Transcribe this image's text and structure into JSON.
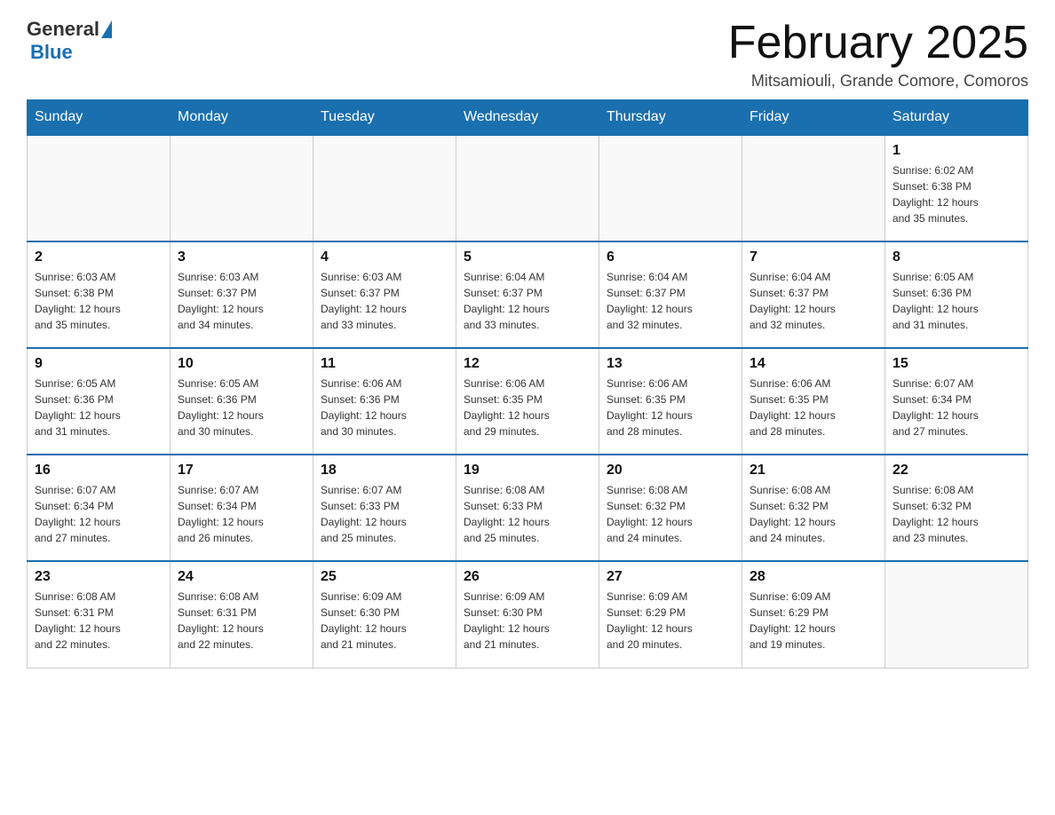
{
  "header": {
    "logo": {
      "part1": "General",
      "part2": "Blue"
    },
    "title": "February 2025",
    "location": "Mitsamiouli, Grande Comore, Comoros"
  },
  "weekdays": [
    "Sunday",
    "Monday",
    "Tuesday",
    "Wednesday",
    "Thursday",
    "Friday",
    "Saturday"
  ],
  "weeks": [
    [
      {
        "day": "",
        "info": ""
      },
      {
        "day": "",
        "info": ""
      },
      {
        "day": "",
        "info": ""
      },
      {
        "day": "",
        "info": ""
      },
      {
        "day": "",
        "info": ""
      },
      {
        "day": "",
        "info": ""
      },
      {
        "day": "1",
        "info": "Sunrise: 6:02 AM\nSunset: 6:38 PM\nDaylight: 12 hours\nand 35 minutes."
      }
    ],
    [
      {
        "day": "2",
        "info": "Sunrise: 6:03 AM\nSunset: 6:38 PM\nDaylight: 12 hours\nand 35 minutes."
      },
      {
        "day": "3",
        "info": "Sunrise: 6:03 AM\nSunset: 6:37 PM\nDaylight: 12 hours\nand 34 minutes."
      },
      {
        "day": "4",
        "info": "Sunrise: 6:03 AM\nSunset: 6:37 PM\nDaylight: 12 hours\nand 33 minutes."
      },
      {
        "day": "5",
        "info": "Sunrise: 6:04 AM\nSunset: 6:37 PM\nDaylight: 12 hours\nand 33 minutes."
      },
      {
        "day": "6",
        "info": "Sunrise: 6:04 AM\nSunset: 6:37 PM\nDaylight: 12 hours\nand 32 minutes."
      },
      {
        "day": "7",
        "info": "Sunrise: 6:04 AM\nSunset: 6:37 PM\nDaylight: 12 hours\nand 32 minutes."
      },
      {
        "day": "8",
        "info": "Sunrise: 6:05 AM\nSunset: 6:36 PM\nDaylight: 12 hours\nand 31 minutes."
      }
    ],
    [
      {
        "day": "9",
        "info": "Sunrise: 6:05 AM\nSunset: 6:36 PM\nDaylight: 12 hours\nand 31 minutes."
      },
      {
        "day": "10",
        "info": "Sunrise: 6:05 AM\nSunset: 6:36 PM\nDaylight: 12 hours\nand 30 minutes."
      },
      {
        "day": "11",
        "info": "Sunrise: 6:06 AM\nSunset: 6:36 PM\nDaylight: 12 hours\nand 30 minutes."
      },
      {
        "day": "12",
        "info": "Sunrise: 6:06 AM\nSunset: 6:35 PM\nDaylight: 12 hours\nand 29 minutes."
      },
      {
        "day": "13",
        "info": "Sunrise: 6:06 AM\nSunset: 6:35 PM\nDaylight: 12 hours\nand 28 minutes."
      },
      {
        "day": "14",
        "info": "Sunrise: 6:06 AM\nSunset: 6:35 PM\nDaylight: 12 hours\nand 28 minutes."
      },
      {
        "day": "15",
        "info": "Sunrise: 6:07 AM\nSunset: 6:34 PM\nDaylight: 12 hours\nand 27 minutes."
      }
    ],
    [
      {
        "day": "16",
        "info": "Sunrise: 6:07 AM\nSunset: 6:34 PM\nDaylight: 12 hours\nand 27 minutes."
      },
      {
        "day": "17",
        "info": "Sunrise: 6:07 AM\nSunset: 6:34 PM\nDaylight: 12 hours\nand 26 minutes."
      },
      {
        "day": "18",
        "info": "Sunrise: 6:07 AM\nSunset: 6:33 PM\nDaylight: 12 hours\nand 25 minutes."
      },
      {
        "day": "19",
        "info": "Sunrise: 6:08 AM\nSunset: 6:33 PM\nDaylight: 12 hours\nand 25 minutes."
      },
      {
        "day": "20",
        "info": "Sunrise: 6:08 AM\nSunset: 6:32 PM\nDaylight: 12 hours\nand 24 minutes."
      },
      {
        "day": "21",
        "info": "Sunrise: 6:08 AM\nSunset: 6:32 PM\nDaylight: 12 hours\nand 24 minutes."
      },
      {
        "day": "22",
        "info": "Sunrise: 6:08 AM\nSunset: 6:32 PM\nDaylight: 12 hours\nand 23 minutes."
      }
    ],
    [
      {
        "day": "23",
        "info": "Sunrise: 6:08 AM\nSunset: 6:31 PM\nDaylight: 12 hours\nand 22 minutes."
      },
      {
        "day": "24",
        "info": "Sunrise: 6:08 AM\nSunset: 6:31 PM\nDaylight: 12 hours\nand 22 minutes."
      },
      {
        "day": "25",
        "info": "Sunrise: 6:09 AM\nSunset: 6:30 PM\nDaylight: 12 hours\nand 21 minutes."
      },
      {
        "day": "26",
        "info": "Sunrise: 6:09 AM\nSunset: 6:30 PM\nDaylight: 12 hours\nand 21 minutes."
      },
      {
        "day": "27",
        "info": "Sunrise: 6:09 AM\nSunset: 6:29 PM\nDaylight: 12 hours\nand 20 minutes."
      },
      {
        "day": "28",
        "info": "Sunrise: 6:09 AM\nSunset: 6:29 PM\nDaylight: 12 hours\nand 19 minutes."
      },
      {
        "day": "",
        "info": ""
      }
    ]
  ]
}
